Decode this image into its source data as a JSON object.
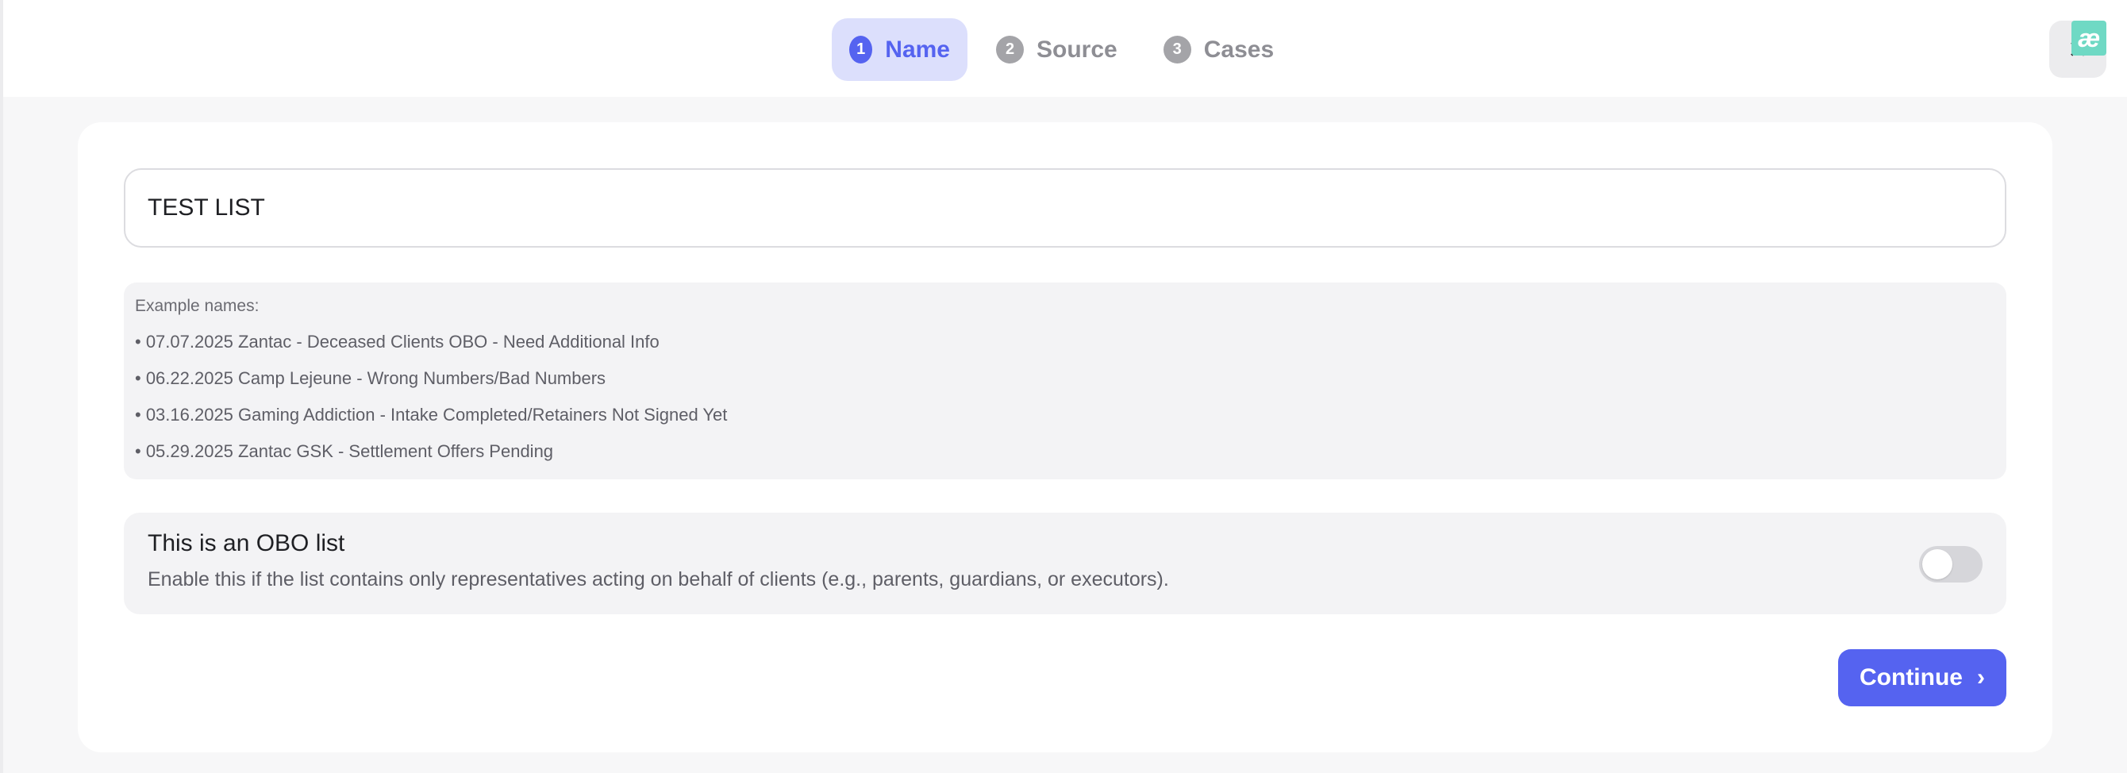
{
  "stepper": {
    "steps": [
      {
        "number": "1",
        "label": "Name",
        "active": true
      },
      {
        "number": "2",
        "label": "Source",
        "active": false
      },
      {
        "number": "3",
        "label": "Cases",
        "active": false
      }
    ]
  },
  "header": {
    "close_icon": "×",
    "corner_logo": "æ"
  },
  "form": {
    "name_value": "TEST LIST",
    "examples": {
      "title": "Example names:",
      "items": [
        "• 07.07.2025 Zantac - Deceased Clients OBO - Need Additional Info",
        "• 06.22.2025 Camp Lejeune - Wrong Numbers/Bad Numbers",
        "• 03.16.2025 Gaming Addiction - Intake Completed/Retainers Not Signed Yet",
        "• 05.29.2025 Zantac GSK - Settlement Offers Pending"
      ]
    },
    "obo": {
      "title": "This is an OBO list",
      "description": "Enable this if the list contains only representatives acting on behalf of clients (e.g., parents, guardians, or executors).",
      "enabled": false
    },
    "continue_label": "Continue",
    "continue_icon": "›"
  },
  "colors": {
    "accent": "#5563f0",
    "accent_light": "#dcdffc",
    "muted_step": "#a4a4a8"
  }
}
